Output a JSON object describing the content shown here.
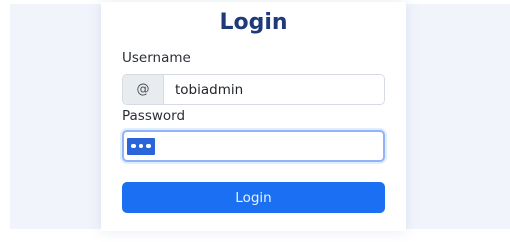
{
  "form": {
    "title": "Login",
    "username_label": "Username",
    "username_prefix": "@",
    "username_value": "tobiadmin",
    "password_label": "Password",
    "password_masked_length": 3,
    "submit_label": "Login"
  },
  "colors": {
    "title": "#1f3a7a",
    "button": "#1a6ff2",
    "focus_border": "#8fb4f7",
    "selection": "#2a66d9",
    "page_band": "#f1f4fb"
  }
}
